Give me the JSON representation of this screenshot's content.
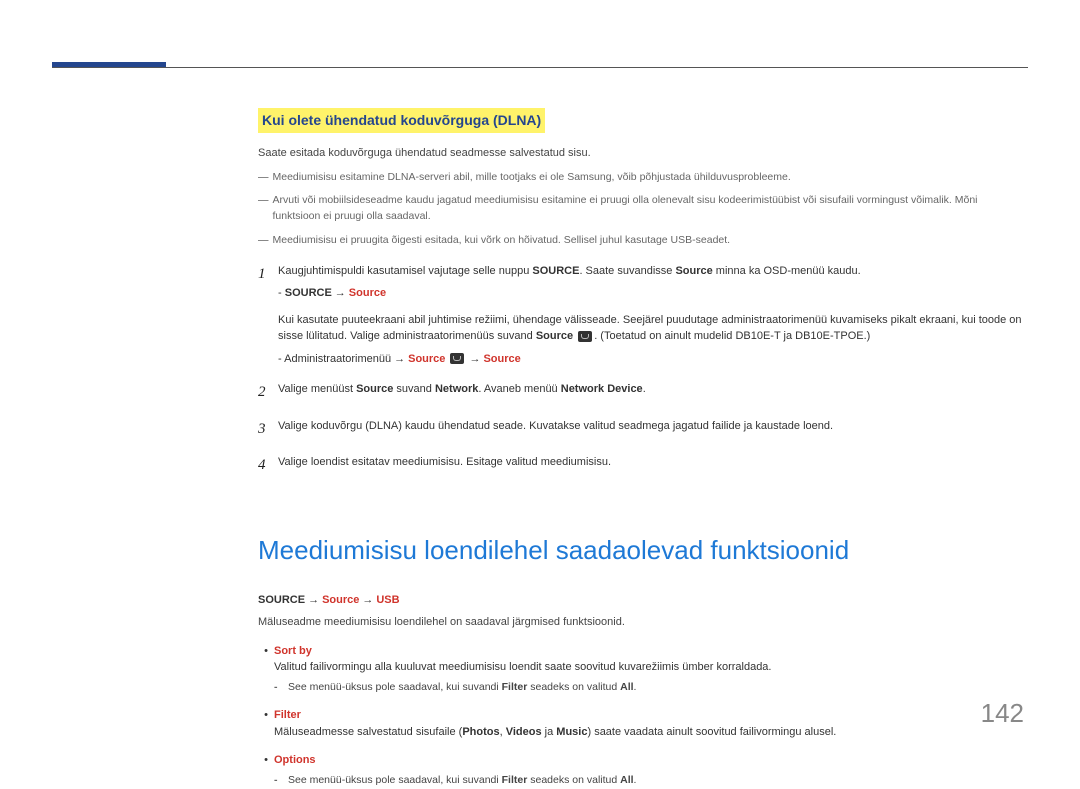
{
  "section1": {
    "title": "Kui olete ühendatud koduvõrguga (DLNA)",
    "intro": "Saate esitada koduvõrguga ühendatud seadmesse salvestatud sisu.",
    "notes": [
      "Meediumisisu esitamine DLNA-serveri abil, mille tootjaks ei ole Samsung, võib põhjustada ühilduvusprobleeme.",
      "Arvuti või mobiilsideseadme kaudu jagatud meediumisisu esitamine ei pruugi olla olenevalt sisu kodeerimistüübist või sisufaili vormingust võimalik. Mõni funktsioon ei pruugi olla saadaval.",
      "Meediumisisu ei pruugita õigesti esitada, kui võrk on hõivatud. Sellisel juhul kasutage USB-seadet."
    ],
    "step1": {
      "pre": "Kaugjuhtimispuldi kasutamisel vajutage selle nuppu ",
      "bold1": "SOURCE",
      "mid": ". Saate suvandisse ",
      "bold2": "Source",
      "post": " minna ka OSD-menüü kaudu.",
      "path_label": "SOURCE",
      "path_target": "Source",
      "sub2_pre": "Kui kasutate puuteekraani abil juhtimise režiimi, ühendage välisseade. Seejärel puudutage administraatorimenüü kuvamiseks pikalt ekraani, kui toode on sisse lülitatud. Valige administraatorimenüüs suvand ",
      "sub2_bold": "Source",
      "sub2_post": ". (Toetatud on ainult mudelid DB10E-T ja DB10E-TPOE.)",
      "sub3_pre": "- Administraatorimenüü",
      "sub3_a": "Source",
      "sub3_b": "Source"
    },
    "step2": {
      "t1": "Valige menüüst ",
      "b1": "Source",
      "t2": " suvand ",
      "b2": "Network",
      "t3": ". Avaneb menüü ",
      "b3": "Network Device",
      "t4": "."
    },
    "step3": "Valige koduvõrgu (DLNA) kaudu ühendatud seade. Kuvatakse valitud seadmega jagatud failide ja kaustade loend.",
    "step4": "Valige loendist esitatav meediumisisu. Esitage valitud meediumisisu."
  },
  "section2": {
    "title": "Meediumisisu loendilehel saadaolevad funktsioonid",
    "path_a": "SOURCE",
    "path_b": "Source",
    "path_c": "USB",
    "intro": "Mäluseadme meediumisisu loendilehel on saadaval järgmised funktsioonid.",
    "bullets": [
      {
        "name": "Sort by",
        "desc": "Valitud failivormingu alla kuuluvat meediumisisu loendit saate soovitud kuvarežiimis ümber korraldada.",
        "sub_pre": "See menüü-üksus pole saadaval, kui suvandi ",
        "sub_bold": "Filter",
        "sub_mid": " seadeks on valitud ",
        "sub_bold2": "All",
        "sub_post": "."
      },
      {
        "name": "Filter",
        "desc_pre": "Mäluseadmesse salvestatud sisufaile (",
        "desc_b1": "Photos",
        "desc_m1": ", ",
        "desc_b2": "Videos",
        "desc_m2": " ja ",
        "desc_b3": "Music",
        "desc_post": ") saate vaadata ainult soovitud failivormingu alusel."
      },
      {
        "name": "Options",
        "sub_pre": "See menüü-üksus pole saadaval, kui suvandi ",
        "sub_bold": "Filter",
        "sub_mid": " seadeks on valitud ",
        "sub_bold2": "All",
        "sub_post": "."
      }
    ]
  },
  "page_number": "142"
}
